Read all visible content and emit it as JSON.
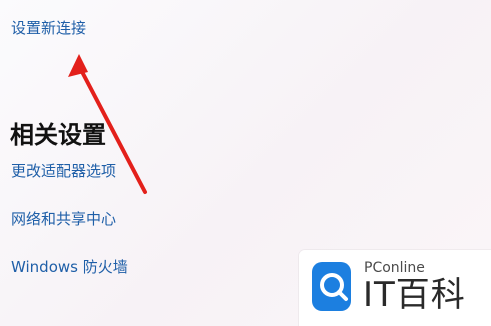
{
  "links": {
    "setup_new_connection": "设置新连接",
    "change_adapter_options": "更改适配器选项",
    "network_sharing_center": "网络和共享中心",
    "windows_firewall": "Windows 防火墙"
  },
  "related_settings": {
    "title": "相关设置"
  },
  "watermark": {
    "brand": "PConline",
    "title": "IT百科"
  },
  "colors": {
    "link": "#1f5fa8",
    "arrow": "#e3201b",
    "logo_blue": "#1c7fe0",
    "background": "#f7f4f8"
  }
}
